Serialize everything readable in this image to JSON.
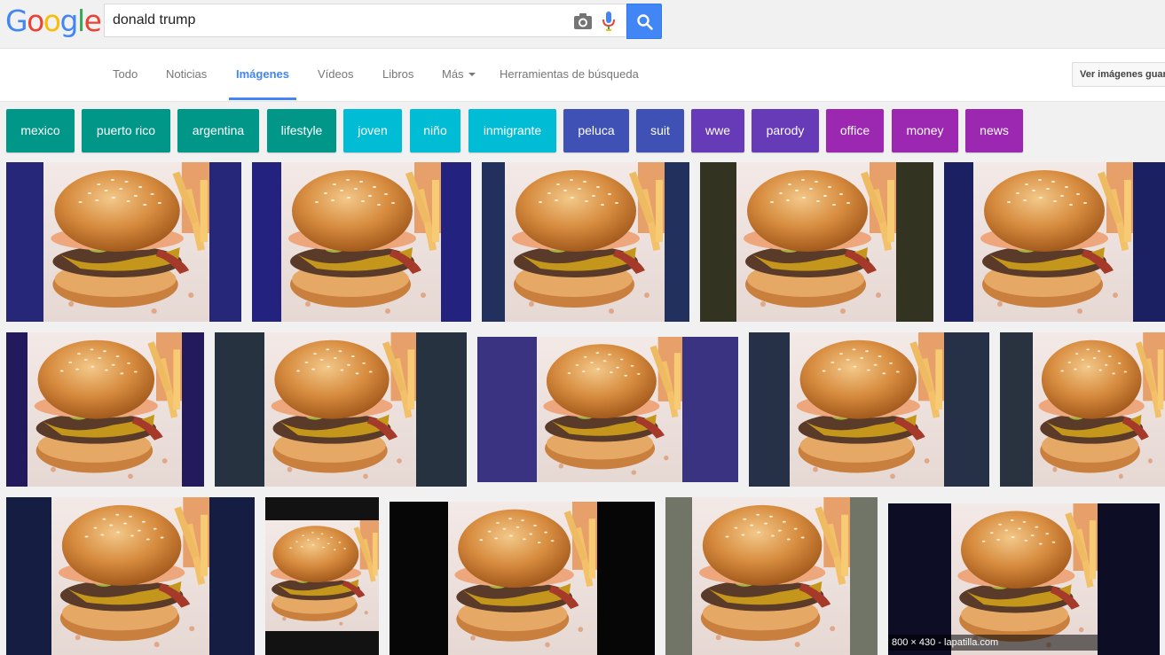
{
  "search": {
    "query": "donald trump"
  },
  "logo": {
    "letters": [
      "G",
      "o",
      "o",
      "g",
      "l",
      "e"
    ],
    "colors": [
      "#4285f4",
      "#ea4335",
      "#fbbc05",
      "#4285f4",
      "#34a853",
      "#ea4335"
    ]
  },
  "nav": {
    "tabs": [
      {
        "label": "Todo",
        "active": false
      },
      {
        "label": "Noticias",
        "active": false
      },
      {
        "label": "Imágenes",
        "active": true
      },
      {
        "label": "Vídeos",
        "active": false
      },
      {
        "label": "Libros",
        "active": false
      },
      {
        "label": "Más",
        "active": false
      },
      {
        "label": "Herramientas de búsqueda",
        "active": false
      }
    ],
    "safe_button": "Ver imágenes guardadas"
  },
  "chips": [
    {
      "label": "mexico",
      "color": "#009688"
    },
    {
      "label": "puerto rico",
      "color": "#009688"
    },
    {
      "label": "argentina",
      "color": "#009688"
    },
    {
      "label": "lifestyle",
      "color": "#009688"
    },
    {
      "label": "joven",
      "color": "#00bcd4"
    },
    {
      "label": "niño",
      "color": "#00bcd4"
    },
    {
      "label": "inmigrante",
      "color": "#00bcd4"
    },
    {
      "label": "peluca",
      "color": "#3f51b5"
    },
    {
      "label": "suit",
      "color": "#3f51b5"
    },
    {
      "label": "wwe",
      "color": "#673ab7"
    },
    {
      "label": "parody",
      "color": "#673ab7"
    },
    {
      "label": "office",
      "color": "#9c27b0"
    },
    {
      "label": "money",
      "color": "#9c27b0"
    },
    {
      "label": "news",
      "color": "#9c27b0"
    }
  ],
  "results": {
    "hover_caption": "800 × 430 - lapatilla.com",
    "bar_colors": [
      "#27277a",
      "#23237f",
      "#21305c",
      "#333321",
      "#1b2062",
      "#221a5c",
      "#273240",
      "#3a3382",
      "#263046",
      "#28333f",
      "#151d42",
      "#121212",
      "#060606",
      "#717568",
      "#0d0d26"
    ]
  },
  "icons": {
    "camera": "camera-icon",
    "mic": "microphone-icon",
    "search": "search-icon",
    "dropdown": "chevron-down-icon"
  }
}
